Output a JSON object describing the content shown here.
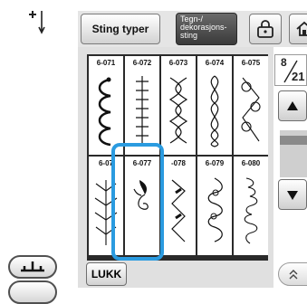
{
  "toolbar": {
    "stitch_types_label": "Sting typer",
    "dekor_lines": [
      "Tegn-/",
      "dekorasjons-",
      "sting"
    ],
    "lock_icon": "lock-icon",
    "home_icon": "home-icon"
  },
  "left": {
    "needle_icon": "needle-position-icon",
    "presser_icon": "presser-foot-icon"
  },
  "pager": {
    "current": "8",
    "total": "21"
  },
  "stitches": [
    {
      "code": "6-071",
      "pattern": "scallop-hook"
    },
    {
      "code": "6-072",
      "pattern": "ladder"
    },
    {
      "code": "6-073",
      "pattern": "cross-wave"
    },
    {
      "code": "6-074",
      "pattern": "braid"
    },
    {
      "code": "6-075",
      "pattern": "flower-chain"
    },
    {
      "code": "6-07",
      "pattern": "fern"
    },
    {
      "code": "6-077",
      "pattern": "leaf-spiral"
    },
    {
      "code": "-078",
      "pattern": "zigzag-leaf"
    },
    {
      "code": "6-079",
      "pattern": "spiral-chain"
    },
    {
      "code": "6-080",
      "pattern": "loop-chain"
    }
  ],
  "selected_code": "6-077",
  "close_label": "LUKK",
  "colors": {
    "highlight": "#2a9be0",
    "panel": "#e0e0e0",
    "grid_frame": "#2a2a2a"
  }
}
